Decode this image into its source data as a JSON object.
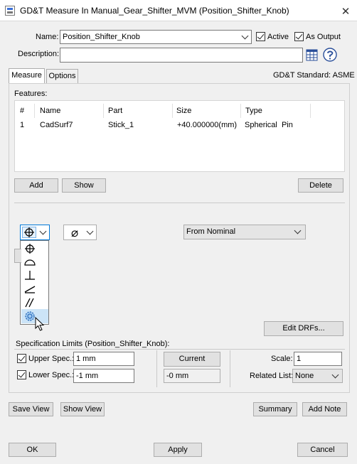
{
  "window": {
    "title": "GD&T Measure In Manual_Gear_Shifter_MVM (Position_Shifter_Knob)",
    "close_glyph": "✕"
  },
  "form": {
    "name_label": "Name:",
    "name_value": "Position_Shifter_Knob",
    "active_label": "Active",
    "as_output_label": "As Output",
    "description_label": "Description:",
    "description_value": ""
  },
  "tabs": [
    {
      "label": "Measure",
      "selected": true
    },
    {
      "label": "Options",
      "selected": false
    }
  ],
  "gdt_standard": "GD&T Standard: ASME",
  "features": {
    "label": "Features:",
    "columns": [
      "#",
      "Name",
      "Part",
      "Size",
      "Type"
    ],
    "rows": [
      {
        "num": "1",
        "name": "CadSurf7",
        "part": "Stick_1",
        "size": "+40.000000(mm)",
        "type": "Spherical  Pin"
      }
    ]
  },
  "buttons": {
    "add": "Add",
    "show": "Show",
    "delete": "Delete",
    "edit_drfs": "Edit DRFs...",
    "current": "Current",
    "save_view": "Save View",
    "show_view": "Show View",
    "summary": "Summary",
    "add_note": "Add Note",
    "ok": "OK",
    "apply": "Apply",
    "cancel": "Cancel"
  },
  "tolerance": {
    "symbol_icon": "position-icon",
    "modifier_icon": "diameter-icon",
    "modifier_glyph": "⌀",
    "nominal_select": "From Nominal",
    "symbol_options": [
      "position-icon",
      "profile-of-line-icon",
      "perpendicularity-icon",
      "angularity-icon",
      "parallelism-icon",
      "circularity-icon"
    ]
  },
  "spec_limits": {
    "title": "Specification Limits (Position_Shifter_Knob):",
    "upper_label": "Upper Spec.:",
    "upper_value": "1 mm",
    "lower_label": "Lower Spec.:",
    "lower_value": "-1 mm",
    "current_value": "-0 mm",
    "scale_label": "Scale:",
    "scale_value": "1",
    "related_list_label": "Related List:",
    "related_list_value": "None"
  },
  "colors": {
    "accent": "#0078d7",
    "background": "#f0f0f0",
    "border": "#adadad"
  }
}
